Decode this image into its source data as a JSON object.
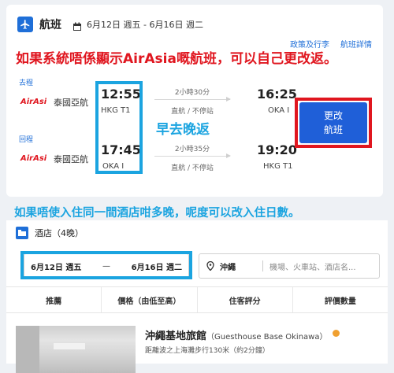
{
  "flight": {
    "title": "航班",
    "dates": "6月12日 週五 - 6月16日 週二",
    "links": [
      "政策及行李",
      "航班詳情"
    ],
    "outbound": {
      "label": "去程",
      "airline": "泰國亞航",
      "depart_time": "12:55",
      "depart_airport": "HKG T1",
      "duration": "2小時30分",
      "nonstop": "直航 / 不停站",
      "arrive_time": "16:25",
      "arrive_airport": "OKA I"
    },
    "inbound": {
      "label": "回程",
      "airline": "泰國亞航",
      "depart_time": "17:45",
      "depart_airport": "OKA I",
      "duration": "2小時35分",
      "nonstop": "直航 / 不停站",
      "arrive_time": "19:20",
      "arrive_airport": "HKG T1"
    },
    "change_button": [
      "更改",
      "航班"
    ]
  },
  "annotations": {
    "red_note": "如果系統唔係顯示AirAsia嘅航班，可以自己更改返。",
    "early_late": "早去晚返",
    "blue_note": "如果唔使入住同一間酒店咁多晚，呢度可以改入住日數。"
  },
  "hotel": {
    "title": "酒店（4晚）",
    "checkin": "6月12日 週五",
    "dash": "—",
    "checkout": "6月16日 週二",
    "location": "沖繩",
    "location_placeholder": "機場、火車站、酒店名..."
  },
  "sort_tabs": [
    "推薦",
    "價格（由低至高）",
    "住客評分",
    "評價數量"
  ],
  "listing": {
    "name": "沖繩基地旅館",
    "name_en": "（Guesthouse Base Okinawa）",
    "distance": "距離波之上海灘步行130米（約2分鐘）"
  },
  "colors": {
    "accent": "#1f6fd8",
    "annotation_red": "#e0161f",
    "annotation_blue": "#1ba4e0"
  },
  "icons": [
    "plane-icon",
    "calendar-icon",
    "airasia-logo",
    "hotel-icon",
    "location-pin-icon"
  ]
}
